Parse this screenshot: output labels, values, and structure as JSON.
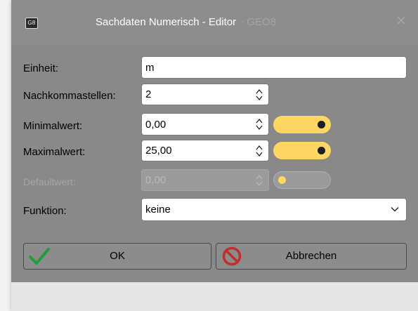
{
  "window": {
    "title": "Sachdaten Numerisch - Editor",
    "title_suffix": "- GEO8",
    "app_icon_text": "G8",
    "close_icon": "close-icon"
  },
  "form": {
    "einheit": {
      "label": "Einheit:",
      "value": "m"
    },
    "nachkommastellen": {
      "label": "Nachkommastellen:",
      "value": "2"
    },
    "minimalwert": {
      "label": "Minimalwert:",
      "value": "0,00",
      "enabled": true
    },
    "maximalwert": {
      "label": "Maximalwert:",
      "value": "25,00",
      "enabled": true
    },
    "defaultwert": {
      "label": "Defaultwert:",
      "value": "0,00",
      "enabled": false
    },
    "funktion": {
      "label": "Funktion:",
      "value": "keine"
    }
  },
  "buttons": {
    "ok": {
      "label": "OK",
      "icon": "checkmark-icon"
    },
    "cancel": {
      "label": "Abbrechen",
      "icon": "prohibited-icon"
    }
  },
  "colors": {
    "toggle_on": "#fdd663",
    "ok_icon": "#1f9d3a",
    "cancel_icon": "#c42b2b"
  }
}
